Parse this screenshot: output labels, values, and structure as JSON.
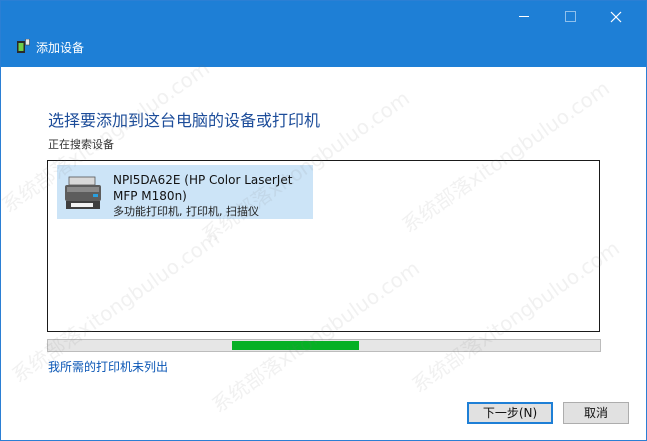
{
  "window": {
    "title": "添加设备",
    "controls": {
      "minimize": "minimize",
      "maximize": "maximize",
      "close": "close"
    }
  },
  "main": {
    "heading": "选择要添加到这台电脑的设备或打印机",
    "status": "正在搜索设备",
    "devices": [
      {
        "name": "NPI5DA62E (HP Color LaserJet MFP M180n)",
        "type": "多功能打印机, 打印机, 扫描仪",
        "icon": "printer-icon",
        "selected": true
      }
    ],
    "progress_fraction": 0.23,
    "missing_printer_link": "我所需的打印机未列出"
  },
  "buttons": {
    "next": "下一步(N)",
    "cancel": "取消"
  },
  "watermark": "系统部落xitongbuluo.com",
  "colors": {
    "titlebar": "#1e7fd6",
    "heading": "#1d4d9a",
    "link": "#0a56b5",
    "progress": "#06b025",
    "selection": "#cce4f7"
  }
}
